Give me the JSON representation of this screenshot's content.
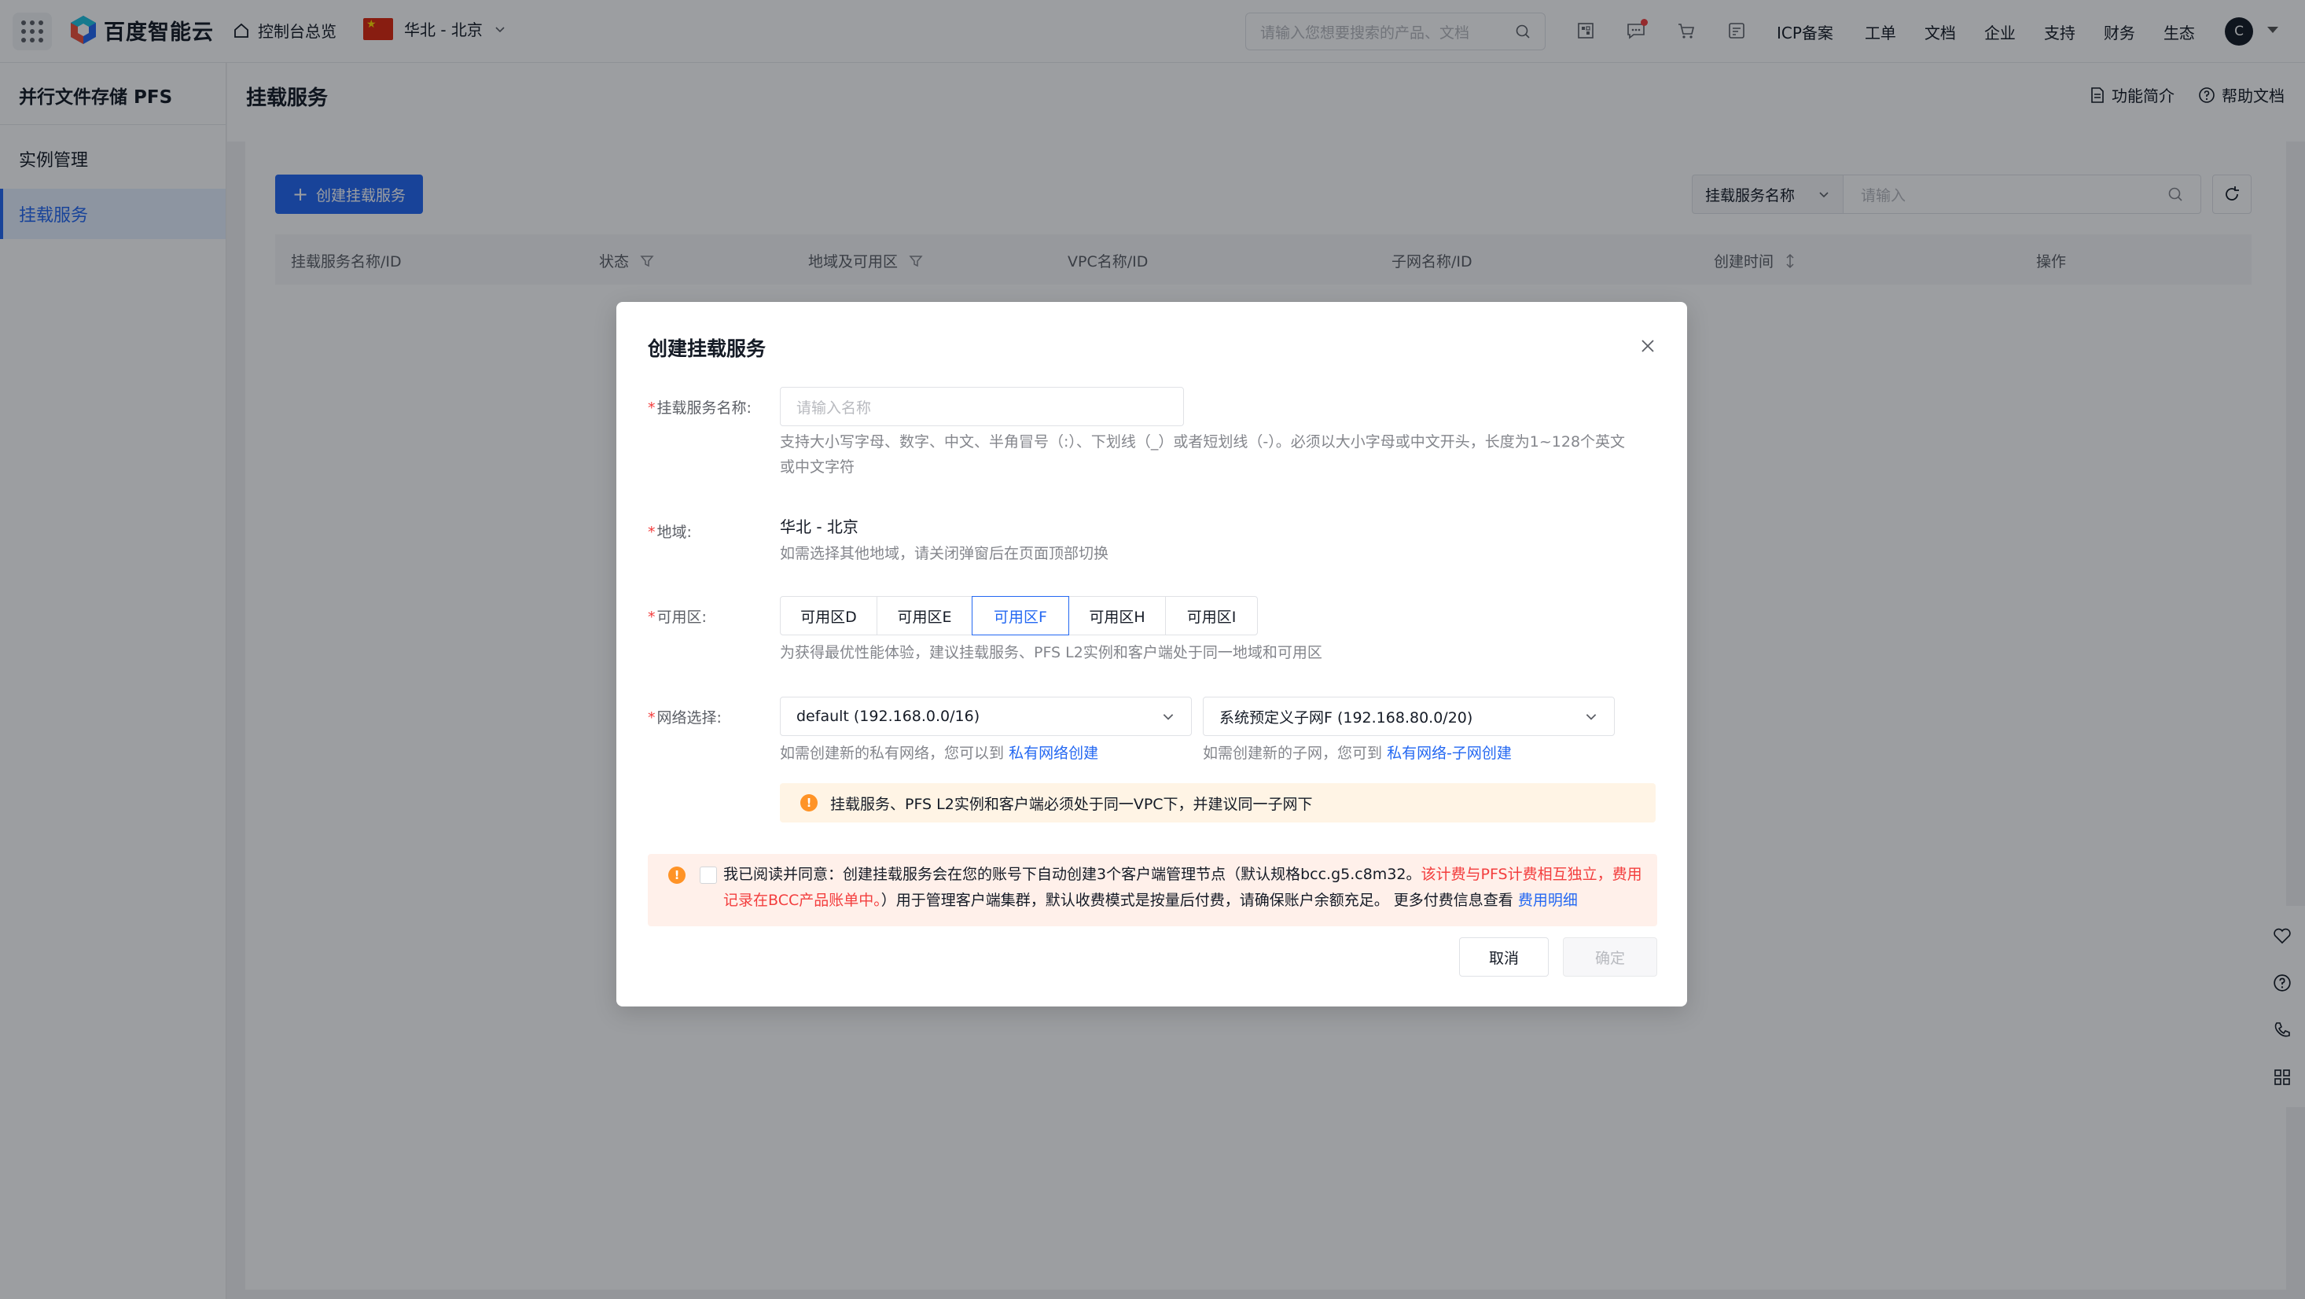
{
  "topbar": {
    "brand": "百度智能云",
    "home_label": "控制台总览",
    "region_label": "华北 - 北京",
    "search_placeholder": "请输入您想要搜索的产品、文档",
    "icons": [
      "qrcode-icon",
      "message-icon",
      "cart-icon",
      "billing-icon"
    ],
    "links": [
      "ICP备案",
      "工单",
      "文档",
      "企业",
      "支持",
      "财务",
      "生态"
    ],
    "avatar_initial": "C"
  },
  "sidebar": {
    "title": "并行文件存储 PFS",
    "items": [
      {
        "label": "实例管理",
        "active": false
      },
      {
        "label": "挂载服务",
        "active": true
      }
    ]
  },
  "page": {
    "title": "挂载服务",
    "intro_link": "功能简介",
    "help_link": "帮助文档",
    "create_button": "创建挂载服务",
    "filter_field": "挂载服务名称",
    "filter_placeholder": "请输入",
    "table_columns": [
      "挂载服务名称/ID",
      "状态",
      "地域及可用区",
      "VPC名称/ID",
      "子网名称/ID",
      "创建时间",
      "操作"
    ]
  },
  "modal": {
    "title": "创建挂载服务",
    "name_label": "挂载服务名称:",
    "name_placeholder": "请输入名称",
    "name_hint": "支持大小写字母、数字、中文、半角冒号（:）、下划线（_）或者短划线（-）。必须以大小字母或中文开头，长度为1~128个英文或中文字符",
    "region_label": "地域:",
    "region_value": "华北 - 北京",
    "region_hint": "如需选择其他地域，请关闭弹窗后在页面顶部切换",
    "az_label": "可用区:",
    "zones": [
      {
        "label": "可用区D",
        "selected": false
      },
      {
        "label": "可用区E",
        "selected": false
      },
      {
        "label": "可用区F",
        "selected": true
      },
      {
        "label": "可用区H",
        "selected": false
      },
      {
        "label": "可用区I",
        "selected": false
      }
    ],
    "az_hint": "为获得最优性能体验，建议挂载服务、PFS L2实例和客户端处于同一地域和可用区",
    "network_label": "网络选择:",
    "vpc_value": "default (192.168.0.0/16)",
    "subnet_value": "系统预定义子网F (192.168.80.0/20)",
    "vpc_hint": "如需创建新的私有网络，您可以到",
    "vpc_link": "私有网络创建",
    "subnet_hint": "如需创建新的子网，您可到",
    "subnet_link": "私有网络-子网创建",
    "network_warning": "挂载服务、PFS L2实例和客户端必须处于同一VPC下，并建议同一子网下",
    "agree_prefix": "我已阅读并同意：创建挂载服务会在您的账号下自动创建3个客户端管理节点（默认规格bcc.g5.c8m32。",
    "agree_red": "该计费与PFS计费相互独立，费用记录在BCC产品账单中。",
    "agree_suffix": "）用于管理客户端集群，默认收费模式是按量后付费，请确保账户余额充足。 更多付费信息查看 ",
    "agree_link": "费用明细",
    "cancel_label": "取消",
    "confirm_label": "确定"
  },
  "colors": {
    "primary": "#2468f2",
    "warning": "#ff9326",
    "danger": "#f33e3e"
  }
}
